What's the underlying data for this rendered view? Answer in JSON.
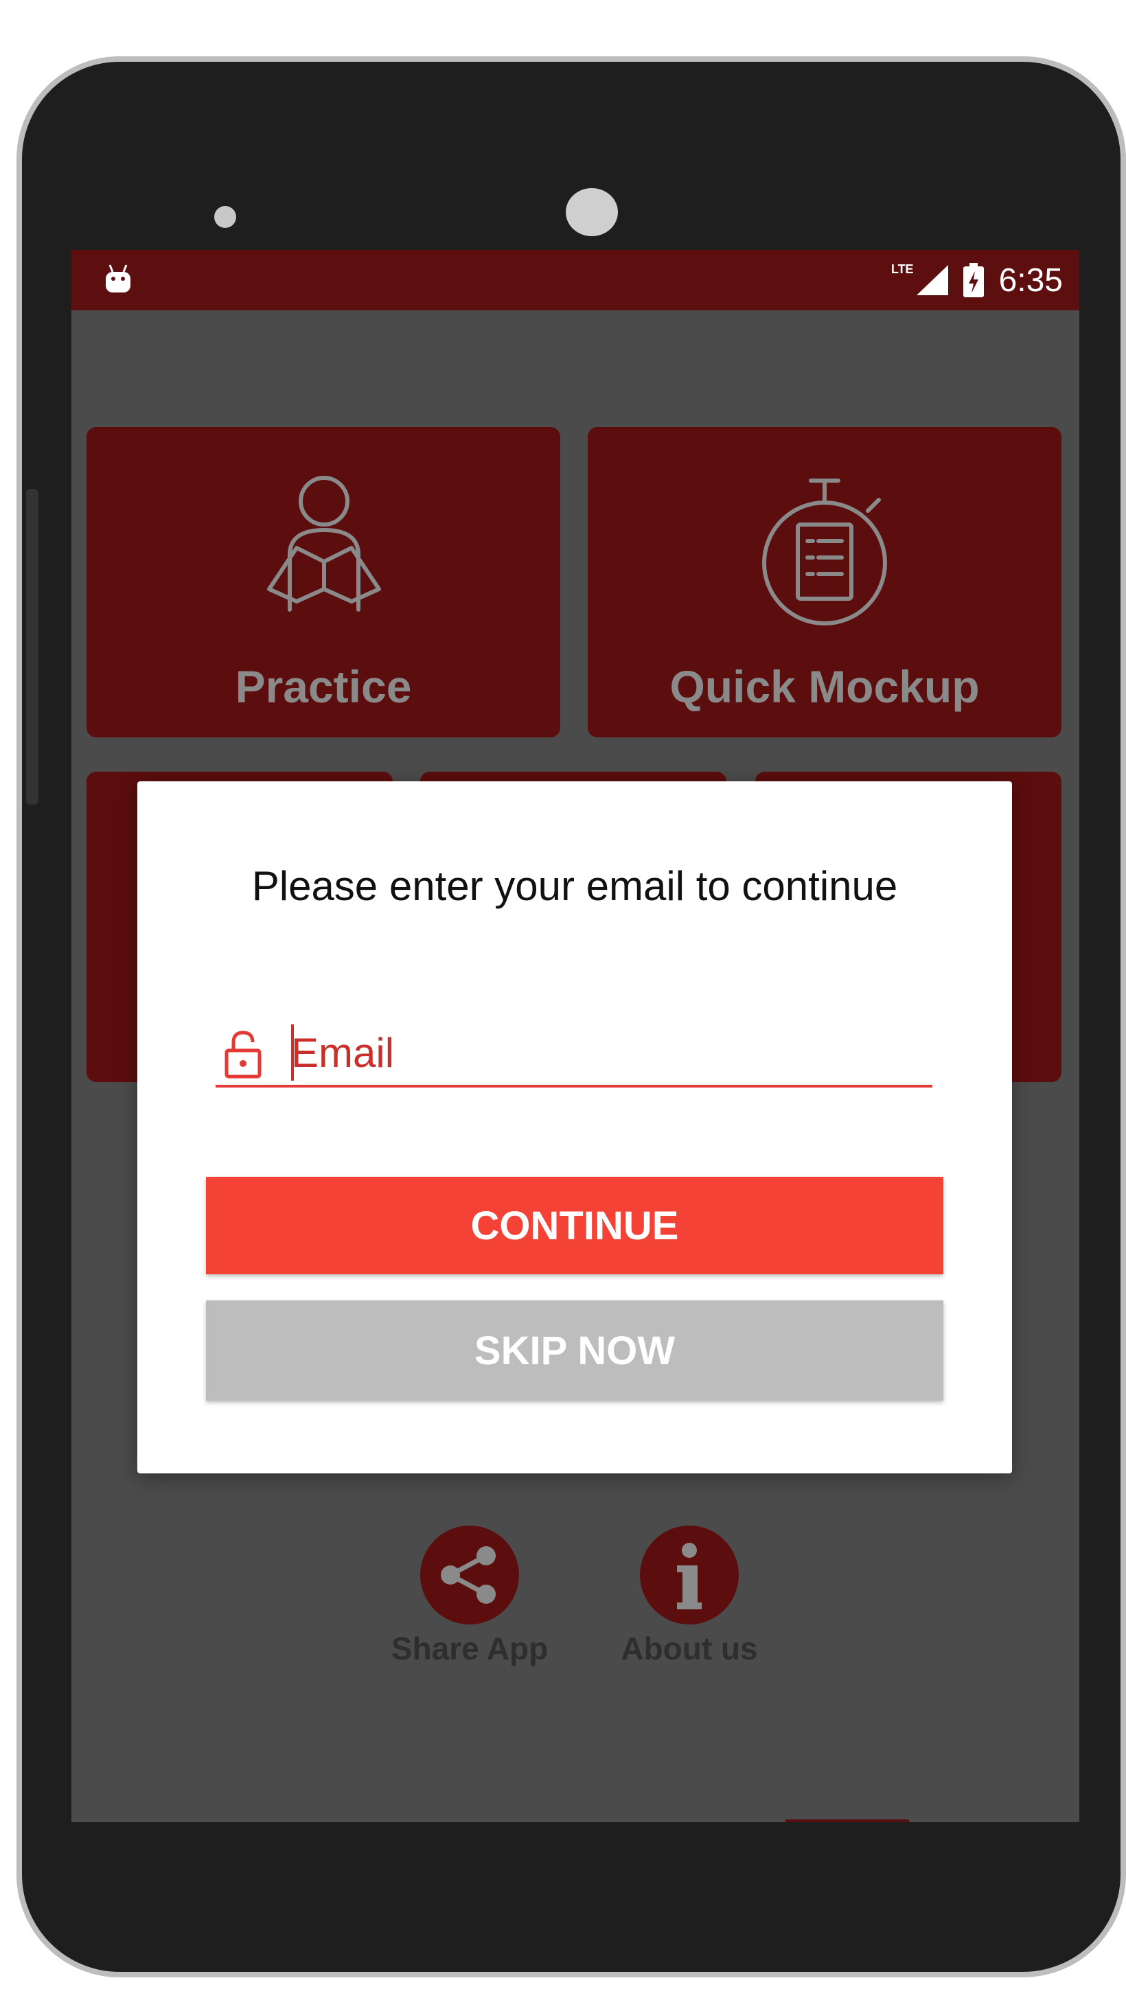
{
  "status_bar": {
    "network": "LTE",
    "time": "6:35"
  },
  "tiles": [
    {
      "label": "Practice",
      "icon": "reading-person-icon"
    },
    {
      "label": "Quick Mockup",
      "icon": "stopwatch-checklist-icon"
    }
  ],
  "dialog": {
    "title": "Please enter your email to continue",
    "email_placeholder": "Email",
    "email_value": "",
    "continue_label": "CONTINUE",
    "skip_label": "SKIP NOW"
  },
  "bottom_actions": [
    {
      "label": "Share App",
      "icon": "share-icon"
    },
    {
      "label": "About us",
      "icon": "info-icon"
    }
  ],
  "colors": {
    "status_bar": "#5d0f0f",
    "tile": "#5c0d0d",
    "accent": "#f44336",
    "skip": "#bdbdbd",
    "overlay": "#4b4b4b"
  }
}
